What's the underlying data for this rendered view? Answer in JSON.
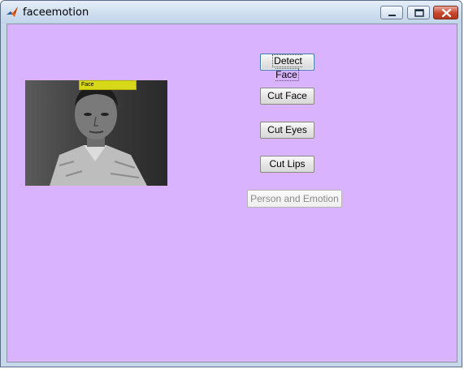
{
  "window": {
    "title": "faceemotion",
    "app_icon": "matlab-icon"
  },
  "camera": {
    "label": "Face"
  },
  "buttons": {
    "detect_face": "Detect Face",
    "cut_face": "Cut Face",
    "cut_eyes": "Cut Eyes",
    "cut_lips": "Cut Lips",
    "person_and_emotion": "Person and Emotion"
  },
  "colors": {
    "background": "#dab3fe",
    "face_box": "#d8d81a",
    "disabled_text": "#8a8a8a"
  }
}
